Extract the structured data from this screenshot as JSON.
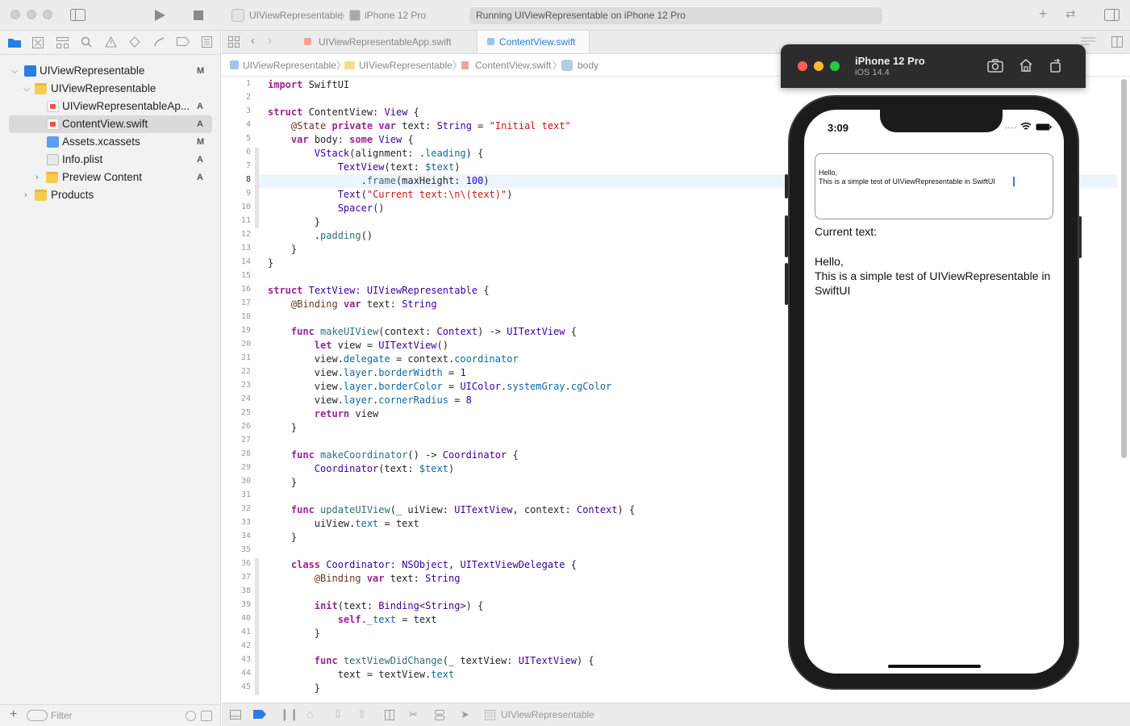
{
  "toolbar": {
    "scheme": "UIViewRepresentable",
    "destination": "iPhone 12 Pro",
    "status": "Running UIViewRepresentable on iPhone 12 Pro"
  },
  "navigator": {
    "items": [
      {
        "label": "UIViewRepresentable",
        "badge": "M"
      },
      {
        "label": "UIViewRepresentable",
        "badge": ""
      },
      {
        "label": "UIViewRepresentableAp...",
        "badge": "A"
      },
      {
        "label": "ContentView.swift",
        "badge": "A"
      },
      {
        "label": "Assets.xcassets",
        "badge": "M"
      },
      {
        "label": "Info.plist",
        "badge": "A"
      },
      {
        "label": "Preview Content",
        "badge": "A"
      },
      {
        "label": "Products",
        "badge": ""
      }
    ],
    "filter_placeholder": "Filter"
  },
  "tabs": [
    {
      "label": "UIViewRepresentableApp.swift"
    },
    {
      "label": "ContentView.swift"
    }
  ],
  "jumpbar": {
    "crumbs": [
      "UIViewRepresentable",
      "UIViewRepresentable",
      "ContentView.swift",
      "body"
    ]
  },
  "editor": {
    "current_line": 8,
    "lines": [
      "import SwiftUI",
      "",
      "struct ContentView: View {",
      "    @State private var text: String = \"Initial text\"",
      "    var body: some View {",
      "        VStack(alignment: .leading) {",
      "            TextView(text: $text)",
      "                .frame(maxHeight: 100)",
      "            Text(\"Current text:\\n\\(text)\")",
      "            Spacer()",
      "        }",
      "        .padding()",
      "    }",
      "}",
      "",
      "struct TextView: UIViewRepresentable {",
      "    @Binding var text: String",
      "",
      "    func makeUIView(context: Context) -> UITextView {",
      "        let view = UITextView()",
      "        view.delegate = context.coordinator",
      "        view.layer.borderWidth = 1",
      "        view.layer.borderColor = UIColor.systemGray.cgColor",
      "        view.layer.cornerRadius = 8",
      "        return view",
      "    }",
      "",
      "    func makeCoordinator() -> Coordinator {",
      "        Coordinator(text: $text)",
      "    }",
      "",
      "    func updateUIView(_ uiView: UITextView, context: Context) {",
      "        uiView.text = text",
      "    }",
      "",
      "    class Coordinator: NSObject, UITextViewDelegate {",
      "        @Binding var text: String",
      "",
      "        init(text: Binding<String>) {",
      "            self._text = text",
      "        }",
      "",
      "        func textViewDidChange(_ textView: UITextView) {",
      "            text = textView.text",
      "        }"
    ]
  },
  "debugbar": {
    "target": "UIViewRepresentable"
  },
  "simulator": {
    "device": "iPhone 12 Pro",
    "os": "iOS 14.4",
    "clock": "3:09",
    "textview_line1": "Hello,",
    "textview_line2": "This is a simple test of UIViewRepresentable in SwiftUI",
    "current_label": "Current text:",
    "current_line1": "Hello,",
    "current_line2": "This is a simple test of UIViewRepresentable in",
    "current_line3": "SwiftUI"
  }
}
